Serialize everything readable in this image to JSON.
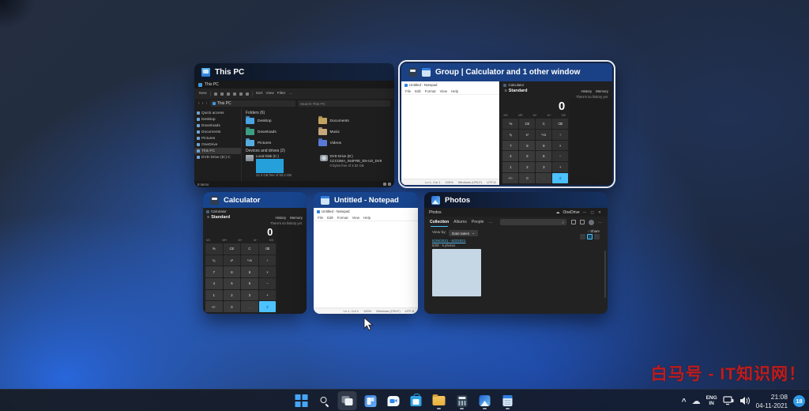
{
  "thumbnails": {
    "this_pc": "This PC",
    "group": "Group | Calculator and 1 other window",
    "calculator": "Calculator",
    "notepad": "Untitled - Notepad",
    "photos": "Photos"
  },
  "explorer": {
    "window_title": "This PC",
    "toolbar": {
      "new": "New",
      "sort": "Sort",
      "view": "View",
      "filter": "Filter",
      "more": "…"
    },
    "address": "This PC",
    "search_placeholder": "Search This PC",
    "sidebar": [
      {
        "label": "Quick access"
      },
      {
        "label": "Desktop"
      },
      {
        "label": "Downloads"
      },
      {
        "label": "Documents"
      },
      {
        "label": "Pictures"
      },
      {
        "label": "OneDrive"
      },
      {
        "label": "This PC",
        "sel": "sel"
      },
      {
        "label": "DVD Drive (D:) C"
      }
    ],
    "folders_header": "Folders (6)",
    "folders": [
      {
        "name": "Desktop",
        "color": "#4aa3e2"
      },
      {
        "name": "Documents",
        "color": "#c2a35e"
      },
      {
        "name": "Downloads",
        "color": "#3c9e83"
      },
      {
        "name": "Music",
        "color": "#c7a87b"
      },
      {
        "name": "Pictures",
        "color": "#56aee0"
      },
      {
        "name": "Videos",
        "color": "#5a79d6"
      }
    ],
    "devices_header": "Devices and drives (2)",
    "disk_name": "Local Disk (C:)",
    "disk_info": "42.3 GB free of 50.2 GB",
    "dvd_name": "DVD Drive (D:)",
    "dvd_label": "CCCOMA_X64FRE_EN-US_DV9",
    "dvd_info": "0 bytes free of 4.52 GB",
    "status_items": "8 items",
    "status_sel": "1"
  },
  "calc": {
    "window_title": "Calculator",
    "mode": "Standard",
    "history_tab": "History",
    "memory_tab": "Memory",
    "no_history": "There's no history yet",
    "display": "0",
    "memory_keys": [
      "MC",
      "MR",
      "M+",
      "M−",
      "MS"
    ],
    "keys": [
      {
        "t": "%",
        "c": "op"
      },
      {
        "t": "CE",
        "c": "op"
      },
      {
        "t": "C",
        "c": "op"
      },
      {
        "t": "⌫",
        "c": "op"
      },
      {
        "t": "¹⁄ₓ",
        "c": "op"
      },
      {
        "t": "x²",
        "c": "op"
      },
      {
        "t": "²√x",
        "c": "op"
      },
      {
        "t": "÷",
        "c": "op"
      },
      {
        "t": "7",
        "c": "num"
      },
      {
        "t": "8",
        "c": "num"
      },
      {
        "t": "9",
        "c": "num"
      },
      {
        "t": "×",
        "c": "op"
      },
      {
        "t": "4",
        "c": "num"
      },
      {
        "t": "5",
        "c": "num"
      },
      {
        "t": "6",
        "c": "num"
      },
      {
        "t": "−",
        "c": "op"
      },
      {
        "t": "1",
        "c": "num"
      },
      {
        "t": "2",
        "c": "num"
      },
      {
        "t": "3",
        "c": "num"
      },
      {
        "t": "+",
        "c": "op"
      },
      {
        "t": "+/−",
        "c": "num"
      },
      {
        "t": "0",
        "c": "num"
      },
      {
        "t": ".",
        "c": "num"
      },
      {
        "t": "=",
        "c": "eq"
      }
    ]
  },
  "notepad": {
    "window_title": "Untitled - Notepad",
    "menus": [
      "File",
      "Edit",
      "Format",
      "View",
      "Help"
    ],
    "status": [
      "Ln 1, Col 1",
      "100%",
      "Windows (CRLF)",
      "UTF-8"
    ]
  },
  "photos": {
    "window_title": "Photos",
    "onedrive": "OneDrive",
    "window_controls": "—  ▢  ✕",
    "tabs": [
      {
        "label": "Collection",
        "sel": "sel"
      },
      {
        "label": "Albums"
      },
      {
        "label": "People"
      }
    ],
    "more": "…",
    "viewby_label": "View by:",
    "viewby_value": "Date taken",
    "share": "↑ Share",
    "date_link": "5/29/2021 - 6/2/2021",
    "count": "5/29 · 5 photos"
  },
  "taskbar": {
    "icons": [
      "start",
      "search",
      "task-view",
      "widgets",
      "chat",
      "store",
      "file-explorer",
      "calculator",
      "photos",
      "notepad"
    ]
  },
  "tray": {
    "chevron": "^",
    "lang_top": "ENG",
    "lang_bottom": "IN",
    "time": "21:08",
    "date": "04-11-2021",
    "badge": "18"
  },
  "watermark": "白马号 - IT知识网！"
}
